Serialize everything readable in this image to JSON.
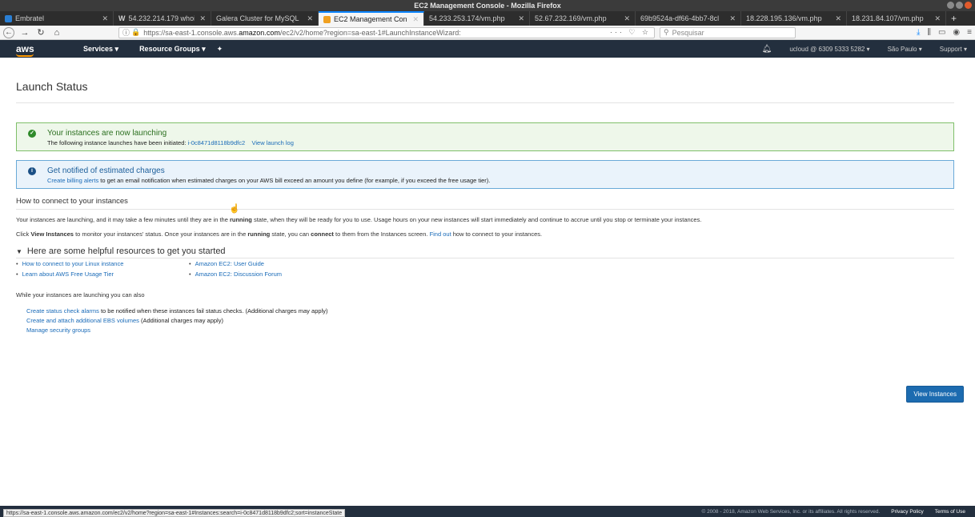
{
  "window": {
    "title": "EC2 Management Console - Mozilla Firefox"
  },
  "tabs": [
    {
      "label": "Embratel",
      "active": false,
      "icon": "blue"
    },
    {
      "label": "54.232.214.179 whois",
      "active": false,
      "icon": "w"
    },
    {
      "label": "Galera Cluster for MySQL",
      "active": false,
      "icon": ""
    },
    {
      "label": "EC2 Management Con",
      "active": true,
      "icon": "orange"
    },
    {
      "label": "54.233.253.174/vm.php",
      "active": false,
      "icon": ""
    },
    {
      "label": "52.67.232.169/vm.php",
      "active": false,
      "icon": ""
    },
    {
      "label": "69b9524a-df66-4bb7-8cl",
      "active": false,
      "icon": ""
    },
    {
      "label": "18.228.195.136/vm.php",
      "active": false,
      "icon": ""
    },
    {
      "label": "18.231.84.107/vm.php",
      "active": false,
      "icon": ""
    }
  ],
  "urlbar": {
    "prefix": "https://sa-east-1.console.aws.",
    "domain": "amazon.com",
    "suffix": "/ec2/v2/home?region=sa-east-1#LaunchInstanceWizard:",
    "actions": "··· ♡ ☆"
  },
  "search": {
    "placeholder": "Pesquisar"
  },
  "aws_nav": {
    "logo": "aws",
    "services": "Services ▾",
    "resource_groups": "Resource Groups ▾",
    "pin": "✦",
    "account": "ucloud @ 6309 5333 5282 ▾",
    "region": "São Paulo ▾",
    "support": "Support ▾"
  },
  "page": {
    "title": "Launch Status",
    "success": {
      "title": "Your instances are now launching",
      "text": "The following instance launches have been initiated: ",
      "instance_id": "i-0c8471d8118b9dfc2",
      "log_link": "View launch log"
    },
    "info": {
      "title": "Get notified of estimated charges",
      "link": "Create billing alerts",
      "text": " to get an email notification when estimated charges on your AWS bill exceed an amount you define (for example, if you exceed the free usage tier)."
    },
    "connect": {
      "heading": "How to connect to your instances",
      "p1_a": "Your instances are launching, and it may take a few minutes until they are in the ",
      "p1_bold": "running",
      "p1_b": " state, when they will be ready for you to use. Usage hours on your new instances will start immediately and continue to accrue until you stop or terminate your instances.",
      "p2_a": "Click ",
      "p2_bold1": "View Instances",
      "p2_b": " to monitor your instances' status. Once your instances are in the ",
      "p2_bold2": "running",
      "p2_c": " state, you can ",
      "p2_bold3": "connect",
      "p2_d": " to them from the Instances screen. ",
      "p2_link": "Find out",
      "p2_e": " how to connect to your instances."
    },
    "resources": {
      "heading": "Here are some helpful resources to get you started",
      "items": [
        "How to connect to your Linux instance",
        "Amazon EC2: User Guide",
        "Learn about AWS Free Usage Tier",
        "Amazon EC2: Discussion Forum"
      ]
    },
    "also": {
      "heading": "While your instances are launching you can also",
      "item1_link": "Create status check alarms",
      "item1_text": " to be notified when these instances fail status checks. (Additional charges may apply)",
      "item2_link": "Create and attach additional EBS volumes",
      "item2_text": " (Additional charges may apply)",
      "item3_link": "Manage security groups"
    },
    "view_button": "View Instances"
  },
  "footer": {
    "copyright": "© 2008 - 2018, Amazon Web Services, Inc. or its affiliates. All rights reserved.",
    "privacy": "Privacy Policy",
    "terms": "Terms of Use"
  },
  "statusbar": "https://sa-east-1.console.aws.amazon.com/ec2/v2/home?region=sa-east-1#Instances:search=i-0c8471d8118b9dfc2;sort=instanceState"
}
